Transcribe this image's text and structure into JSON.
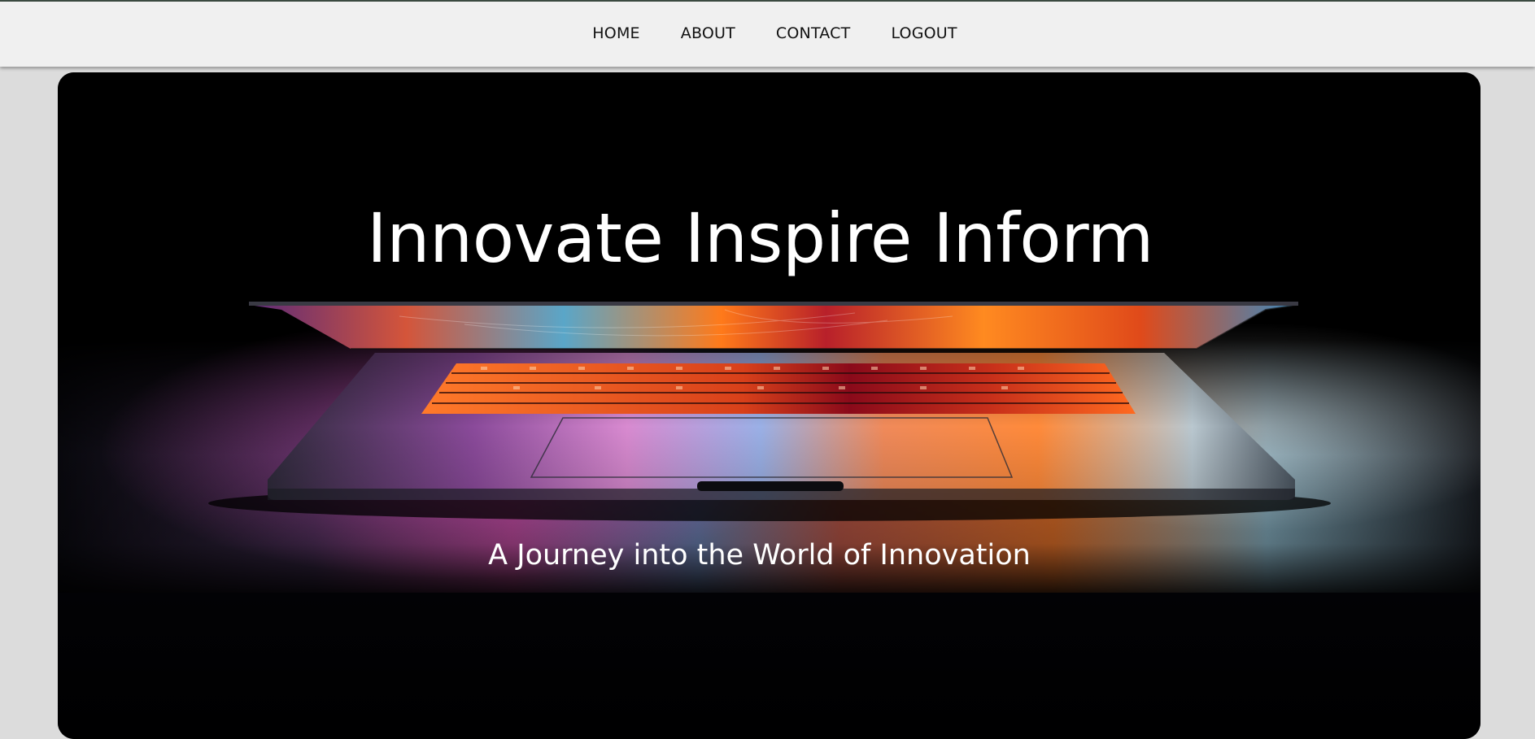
{
  "nav": {
    "items": [
      {
        "label": "HOME"
      },
      {
        "label": "ABOUT"
      },
      {
        "label": "CONTACT"
      },
      {
        "label": "LOGOUT"
      }
    ]
  },
  "hero": {
    "title": "Innovate Inspire Inform",
    "subtitle": "A Journey into the World of Innovation",
    "image": "laptop-photo"
  },
  "colors": {
    "nav_bg": "#f0f0f0",
    "page_bg": "#dcdcdc",
    "hero_bg": "#000000",
    "text_light": "#ffffff",
    "accent_orange": "#ff6a1a",
    "accent_magenta": "#c23a9a",
    "accent_cyan": "#3ab8d8"
  }
}
